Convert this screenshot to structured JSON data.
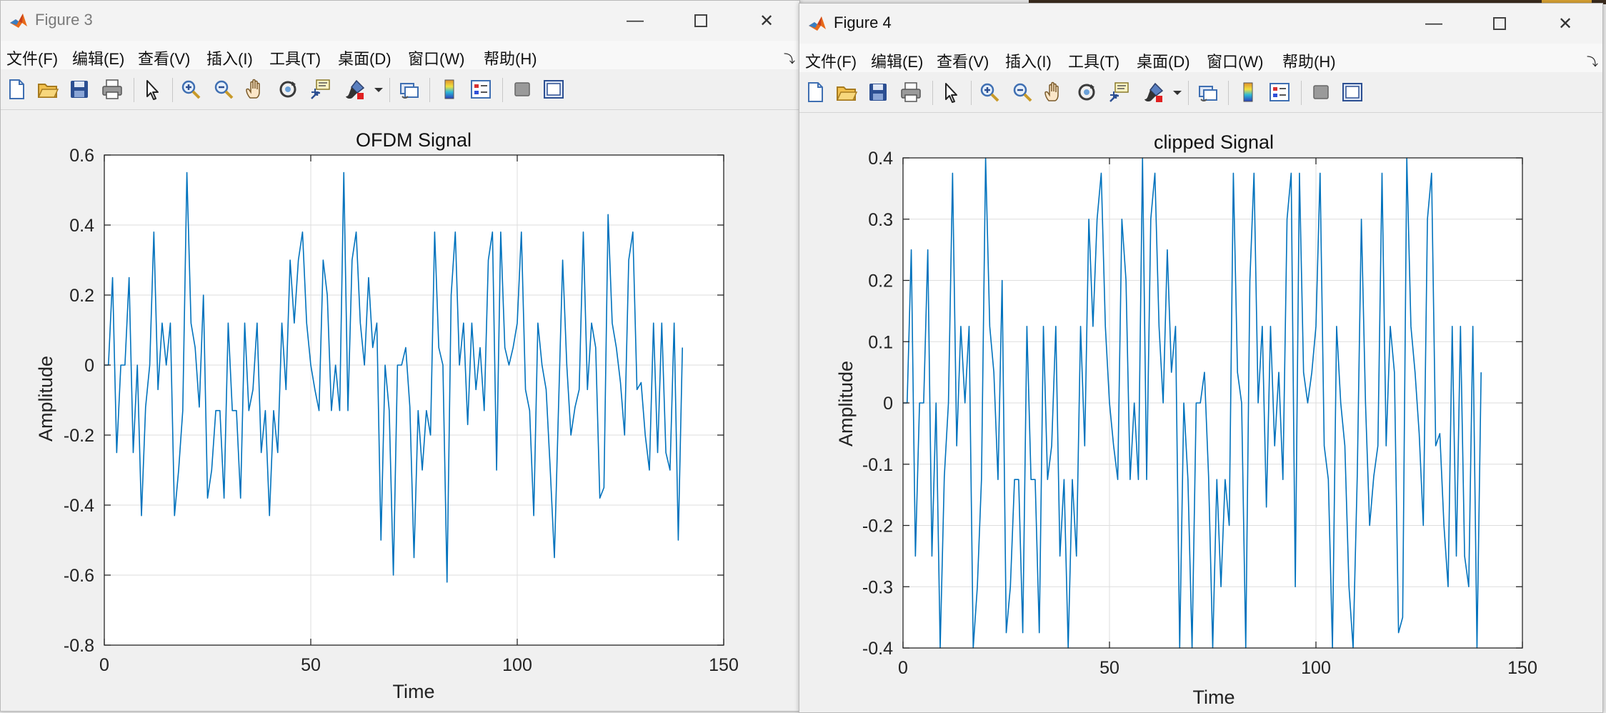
{
  "windows": [
    {
      "title": "Figure 3",
      "menu": [
        "文件(F)",
        "编辑(E)",
        "查看(V)",
        "插入(I)",
        "工具(T)",
        "桌面(D)",
        "窗口(W)",
        "帮助(H)"
      ],
      "chart_data": {
        "type": "line",
        "title": "OFDM Signal",
        "xlabel": "Time",
        "ylabel": "Amplitude",
        "xlim": [
          0,
          150
        ],
        "ylim": [
          -0.8,
          0.6
        ],
        "xticks": [
          0,
          50,
          100,
          150
        ],
        "yticks": [
          -0.8,
          -0.6,
          -0.4,
          -0.2,
          0,
          0.2,
          0.4,
          0.6
        ],
        "xtick_labels": [
          "0",
          "50",
          "100",
          "150"
        ],
        "ytick_labels": [
          "-0.8",
          "-0.6",
          "-0.4",
          "-0.2",
          "0",
          "0.2",
          "0.4",
          "0.6"
        ],
        "grid": true,
        "color": "#0072bd",
        "series": [
          {
            "values": [
              0,
              0,
              0.25,
              -0.25,
              0,
              0,
              0.25,
              -0.25,
              0,
              -0.43,
              -0.12,
              0,
              0.38,
              -0.07,
              0.12,
              0,
              0.12,
              -0.43,
              -0.3,
              -0.13,
              0.55,
              0.12,
              0.05,
              -0.12,
              0.2,
              -0.38,
              -0.3,
              -0.13,
              -0.13,
              -0.38,
              0.12,
              -0.13,
              -0.13,
              -0.38,
              0.12,
              -0.13,
              -0.07,
              0.12,
              -0.25,
              -0.13,
              -0.43,
              -0.13,
              -0.25,
              0.12,
              -0.07,
              0.3,
              0.12,
              0.3,
              0.38,
              0.12,
              0,
              -0.07,
              -0.13,
              0.3,
              0.2,
              -0.13,
              0,
              -0.13,
              0.55,
              -0.13,
              0.3,
              0.38,
              0.12,
              0,
              0.25,
              0.05,
              0.12,
              -0.5,
              0,
              -0.13,
              -0.6,
              0,
              0,
              0.05,
              -0.12,
              -0.55,
              -0.13,
              -0.3,
              -0.13,
              -0.2,
              0.38,
              0.05,
              0,
              -0.62,
              0.2,
              0.38,
              0,
              0.12,
              -0.17,
              0.12,
              -0.07,
              0.05,
              -0.13,
              0.3,
              0.38,
              -0.3,
              0.38,
              0.05,
              0,
              0.05,
              0.12,
              0.38,
              -0.07,
              -0.13,
              -0.43,
              0.12,
              0,
              -0.07,
              -0.3,
              -0.55,
              -0.12,
              0.3,
              0,
              -0.2,
              -0.12,
              -0.07,
              0.38,
              -0.07,
              0.12,
              0.05,
              -0.38,
              -0.35,
              0.43,
              0.12,
              0.05,
              -0.05,
              -0.2,
              0.3,
              0.38,
              -0.07,
              -0.05,
              -0.2,
              -0.3,
              0.12,
              -0.25,
              0.12,
              -0.25,
              -0.3,
              0.12,
              -0.5,
              0.05
            ]
          }
        ]
      }
    },
    {
      "title": "Figure 4",
      "menu": [
        "文件(F)",
        "编辑(E)",
        "查看(V)",
        "插入(I)",
        "工具(T)",
        "桌面(D)",
        "窗口(W)",
        "帮助(H)"
      ],
      "chart_data": {
        "type": "line",
        "title": "clipped Signal",
        "xlabel": "Time",
        "ylabel": "Amplitude",
        "xlim": [
          0,
          150
        ],
        "ylim": [
          -0.4,
          0.4
        ],
        "xticks": [
          0,
          50,
          100,
          150
        ],
        "yticks": [
          -0.4,
          -0.3,
          -0.2,
          -0.1,
          0,
          0.1,
          0.2,
          0.3,
          0.4
        ],
        "xtick_labels": [
          "0",
          "50",
          "100",
          "150"
        ],
        "ytick_labels": [
          "-0.4",
          "-0.3",
          "-0.2",
          "-0.1",
          "0",
          "0.1",
          "0.2",
          "0.3",
          "0.4"
        ],
        "grid": true,
        "clip": 0.4,
        "color": "#0072bd",
        "series": [
          {
            "values": [
              0,
              0,
              0.25,
              -0.25,
              0,
              0,
              0.25,
              -0.25,
              0,
              -0.4,
              -0.12,
              0,
              0.375,
              -0.07,
              0.125,
              0,
              0.125,
              -0.4,
              -0.3,
              -0.125,
              0.4,
              0.125,
              0.05,
              -0.125,
              0.2,
              -0.375,
              -0.3,
              -0.125,
              -0.125,
              -0.375,
              0.125,
              -0.125,
              -0.125,
              -0.375,
              0.125,
              -0.125,
              -0.07,
              0.125,
              -0.25,
              -0.125,
              -0.4,
              -0.125,
              -0.25,
              0.125,
              -0.07,
              0.3,
              0.125,
              0.3,
              0.375,
              0.125,
              0,
              -0.07,
              -0.125,
              0.3,
              0.2,
              -0.125,
              0,
              -0.125,
              0.4,
              -0.125,
              0.3,
              0.375,
              0.125,
              0,
              0.25,
              0.05,
              0.125,
              -0.4,
              0,
              -0.125,
              -0.4,
              0,
              0,
              0.05,
              -0.12,
              -0.4,
              -0.125,
              -0.3,
              -0.125,
              -0.2,
              0.375,
              0.05,
              0,
              -0.4,
              0.2,
              0.375,
              0,
              0.125,
              -0.17,
              0.125,
              -0.07,
              0.05,
              -0.125,
              0.3,
              0.375,
              -0.3,
              0.375,
              0.05,
              0,
              0.05,
              0.125,
              0.375,
              -0.07,
              -0.125,
              -0.4,
              0.125,
              0,
              -0.07,
              -0.3,
              -0.4,
              -0.12,
              0.3,
              0,
              -0.2,
              -0.12,
              -0.07,
              0.375,
              -0.07,
              0.125,
              0.05,
              -0.375,
              -0.35,
              0.4,
              0.125,
              0.05,
              -0.05,
              -0.2,
              0.3,
              0.375,
              -0.07,
              -0.05,
              -0.2,
              -0.3,
              0.125,
              -0.25,
              0.125,
              -0.25,
              -0.3,
              0.125,
              -0.4,
              0.05
            ]
          }
        ]
      }
    }
  ]
}
